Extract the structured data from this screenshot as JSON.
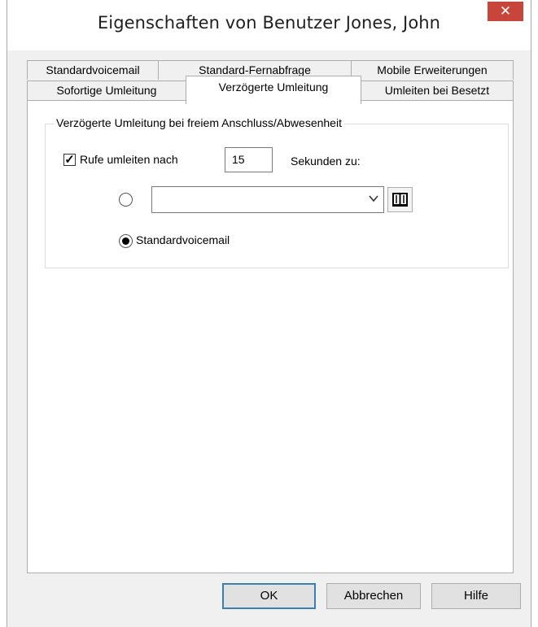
{
  "window": {
    "title": "Eigenschaften von Benutzer Jones, John",
    "close_symbol": "✕"
  },
  "tabs": {
    "back_row": [
      "Standardvoicemail",
      "Standard-Fernabfrage",
      "Mobile Erweiterungen"
    ],
    "front_row": [
      "Sofortige Umleitung",
      "Verzögerte Umleitung",
      "Umleiten bei Besetzt"
    ],
    "selected": "Verzögerte Umleitung"
  },
  "group": {
    "label": "Verzögerte Umleitung bei freiem Anschluss/Abwesenheit",
    "forward_checkbox_label": "Rufe umleiten nach",
    "forward_checked": true,
    "check_mark": "✓",
    "seconds_value": "15",
    "seconds_suffix": "Sekunden zu:",
    "destination_value": "",
    "radio_voicemail_label": "Standardvoicemail",
    "selected_option": "Standardvoicemail"
  },
  "buttons": {
    "ok": "OK",
    "cancel": "Abbrechen",
    "help": "Hilfe"
  },
  "icons": [
    "close-icon",
    "check-icon",
    "chevron-down-icon",
    "address-book-icon"
  ]
}
